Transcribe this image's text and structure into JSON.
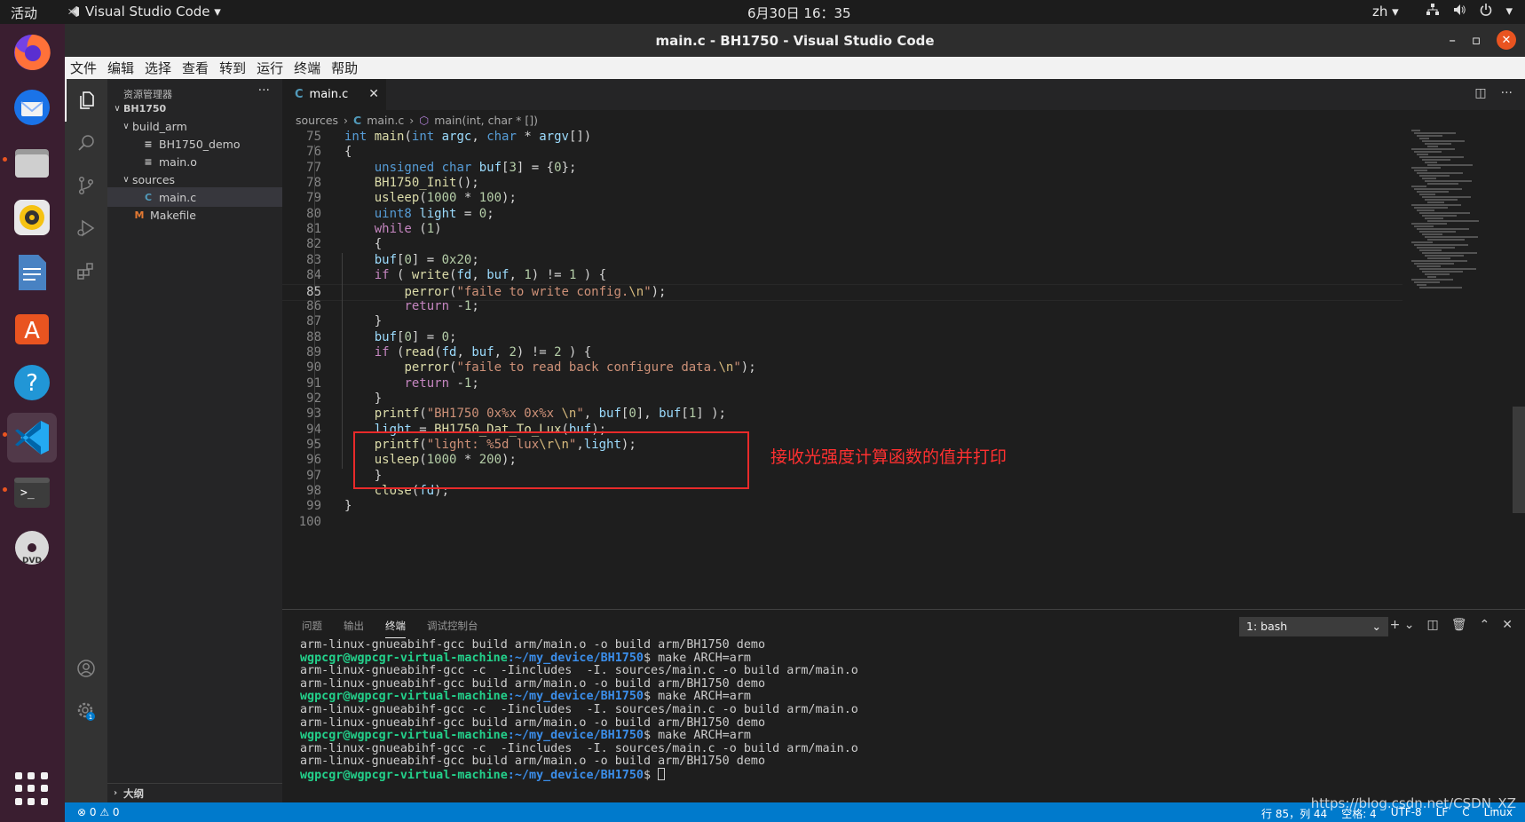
{
  "topbar": {
    "activities": "活动",
    "app_name": "Visual Studio Code ▾",
    "clock": "6月30日  16：35",
    "lang": "zh ▾",
    "tray_icons": [
      "network-icon",
      "volume-icon",
      "power-icon"
    ]
  },
  "window": {
    "title": "main.c - BH1750 - Visual Studio Code",
    "minimize": "–",
    "maximize": "▫",
    "close": "✕"
  },
  "menubar": [
    "文件",
    "编辑",
    "选择",
    "查看",
    "转到",
    "运行",
    "终端",
    "帮助"
  ],
  "sidebar": {
    "header": "资源管理器",
    "more": "···",
    "tree": [
      {
        "label": "BH1750",
        "indent": 0,
        "chevron": "∨",
        "icon": "",
        "bold": true
      },
      {
        "label": "build_arm",
        "indent": 1,
        "chevron": "∨",
        "icon": ""
      },
      {
        "label": "BH1750_demo",
        "indent": 2,
        "chevron": "",
        "icon": "≡"
      },
      {
        "label": "main.o",
        "indent": 2,
        "chevron": "",
        "icon": "≡"
      },
      {
        "label": "sources",
        "indent": 1,
        "chevron": "∨",
        "icon": ""
      },
      {
        "label": "main.c",
        "indent": 2,
        "chevron": "",
        "icon": "C",
        "selected": true
      },
      {
        "label": "Makefile",
        "indent": 1,
        "chevron": "",
        "icon": "M"
      }
    ],
    "outline": "大纲"
  },
  "editor": {
    "tab_label": "main.c",
    "tab_icon": "C",
    "breadcrumb": [
      "sources",
      "main.c",
      "main(int, char * [])"
    ],
    "current_line": 85,
    "lines": [
      {
        "n": 75,
        "html": "<span class='kw'>int</span> <span class='fn'>main</span>(<span class='kw'>int</span> <span class='var'>argc</span>, <span class='kw'>char</span> * <span class='var'>argv</span>[])"
      },
      {
        "n": 76,
        "html": "{"
      },
      {
        "n": 77,
        "html": "    <span class='kw'>unsigned</span> <span class='kw'>char</span> <span class='var'>buf</span>[<span class='num'>3</span>] = {<span class='num'>0</span>};"
      },
      {
        "n": 78,
        "html": "    <span class='fn'>BH1750_Init</span>();"
      },
      {
        "n": 79,
        "html": "    <span class='fn'>usleep</span>(<span class='num'>1000</span> * <span class='num'>100</span>);"
      },
      {
        "n": 80,
        "html": "    <span class='kw'>uint8</span> <span class='var'>light</span> = <span class='num'>0</span>;"
      },
      {
        "n": 81,
        "html": "    <span class='ctrl'>while</span> (<span class='num'>1</span>)"
      },
      {
        "n": 82,
        "html": "    {"
      },
      {
        "n": 83,
        "html": "    <span class='var'>buf</span>[<span class='num'>0</span>] = <span class='num'>0x20</span>;"
      },
      {
        "n": 84,
        "html": "    <span class='ctrl'>if</span> ( <span class='fn'>write</span>(<span class='var'>fd</span>, <span class='var'>buf</span>, <span class='num'>1</span>) != <span class='num'>1</span> ) {"
      },
      {
        "n": 85,
        "html": "        <span class='fn'>perror</span>(<span class='str'>\"faile to write config.</span><span class='esc'>\\n</span><span class='str'>\"</span>);"
      },
      {
        "n": 86,
        "html": "        <span class='ctrl'>return</span> -<span class='num'>1</span>;"
      },
      {
        "n": 87,
        "html": "    }"
      },
      {
        "n": 88,
        "html": "    <span class='var'>buf</span>[<span class='num'>0</span>] = <span class='num'>0</span>;"
      },
      {
        "n": 89,
        "html": "    <span class='ctrl'>if</span> (<span class='fn'>read</span>(<span class='var'>fd</span>, <span class='var'>buf</span>, <span class='num'>2</span>) != <span class='num'>2</span> ) {"
      },
      {
        "n": 90,
        "html": "        <span class='fn'>perror</span>(<span class='str'>\"faile to read back configure data.</span><span class='esc'>\\n</span><span class='str'>\"</span>);"
      },
      {
        "n": 91,
        "html": "        <span class='ctrl'>return</span> -<span class='num'>1</span>;"
      },
      {
        "n": 92,
        "html": "    }"
      },
      {
        "n": 93,
        "html": "    <span class='fn'>printf</span>(<span class='str'>\"BH1750 0x%x 0x%x </span><span class='esc'>\\n</span><span class='str'>\"</span>, <span class='var'>buf</span>[<span class='num'>0</span>], <span class='var'>buf</span>[<span class='num'>1</span>] );"
      },
      {
        "n": 94,
        "html": "    <span class='var'>light</span> = <span class='fn'>BH1750_Dat_To_Lux</span>(<span class='var'>buf</span>);"
      },
      {
        "n": 95,
        "html": "    <span class='fn'>printf</span>(<span class='str'>\"light: %5d lux</span><span class='esc'>\\r\\n</span><span class='str'>\"</span>,<span class='var'>light</span>);"
      },
      {
        "n": 96,
        "html": "    <span class='fn'>usleep</span>(<span class='num'>1000</span> * <span class='num'>200</span>);"
      },
      {
        "n": 97,
        "html": "    }"
      },
      {
        "n": 98,
        "html": "    <span class='fn'>close</span>(<span class='var'>fd</span>);"
      },
      {
        "n": 99,
        "html": "}"
      },
      {
        "n": 100,
        "html": ""
      }
    ],
    "annotation": "接收光强度计算函数的值并打印"
  },
  "panel": {
    "tabs": [
      "问题",
      "输出",
      "终端",
      "调试控制台"
    ],
    "active_tab": 2,
    "terminal_select": "1: bash",
    "terminal": [
      {
        "type": "out",
        "text": "arm-linux-gnueabihf-gcc build arm/main.o -o build arm/BH1750 demo"
      },
      {
        "type": "prompt",
        "user": "wgpcgr@wgpcgr-virtual-machine",
        "path": ":~/my_device/BH1750",
        "cmd": "$ make ARCH=arm"
      },
      {
        "type": "out",
        "text": "arm-linux-gnueabihf-gcc -c  -Iincludes  -I. sources/main.c -o build arm/main.o"
      },
      {
        "type": "out",
        "text": "arm-linux-gnueabihf-gcc build arm/main.o -o build arm/BH1750 demo"
      },
      {
        "type": "prompt",
        "user": "wgpcgr@wgpcgr-virtual-machine",
        "path": ":~/my_device/BH1750",
        "cmd": "$ make ARCH=arm"
      },
      {
        "type": "out",
        "text": "arm-linux-gnueabihf-gcc -c  -Iincludes  -I. sources/main.c -o build arm/main.o"
      },
      {
        "type": "out",
        "text": "arm-linux-gnueabihf-gcc build arm/main.o -o build arm/BH1750 demo"
      },
      {
        "type": "prompt",
        "user": "wgpcgr@wgpcgr-virtual-machine",
        "path": ":~/my_device/BH1750",
        "cmd": "$ make ARCH=arm"
      },
      {
        "type": "out",
        "text": "arm-linux-gnueabihf-gcc -c  -Iincludes  -I. sources/main.c -o build arm/main.o"
      },
      {
        "type": "out",
        "text": "arm-linux-gnueabihf-gcc build arm/main.o -o build arm/BH1750 demo"
      },
      {
        "type": "prompt",
        "user": "wgpcgr@wgpcgr-virtual-machine",
        "path": ":~/my_device/BH1750",
        "cmd": "$ ",
        "cursor": true
      }
    ]
  },
  "statusbar": {
    "problems": "⊗ 0 ⚠ 0",
    "position": "行 85，列 44",
    "spaces": "空格: 4",
    "encoding": "UTF-8",
    "eol": "LF",
    "language": "C",
    "platform": "Linux"
  },
  "watermark": "https://blog.csdn.net/CSDN_XZ",
  "colors": {
    "accent": "#007acc",
    "annotation": "#e82a2a",
    "dock_bg": "#3a1e30"
  }
}
